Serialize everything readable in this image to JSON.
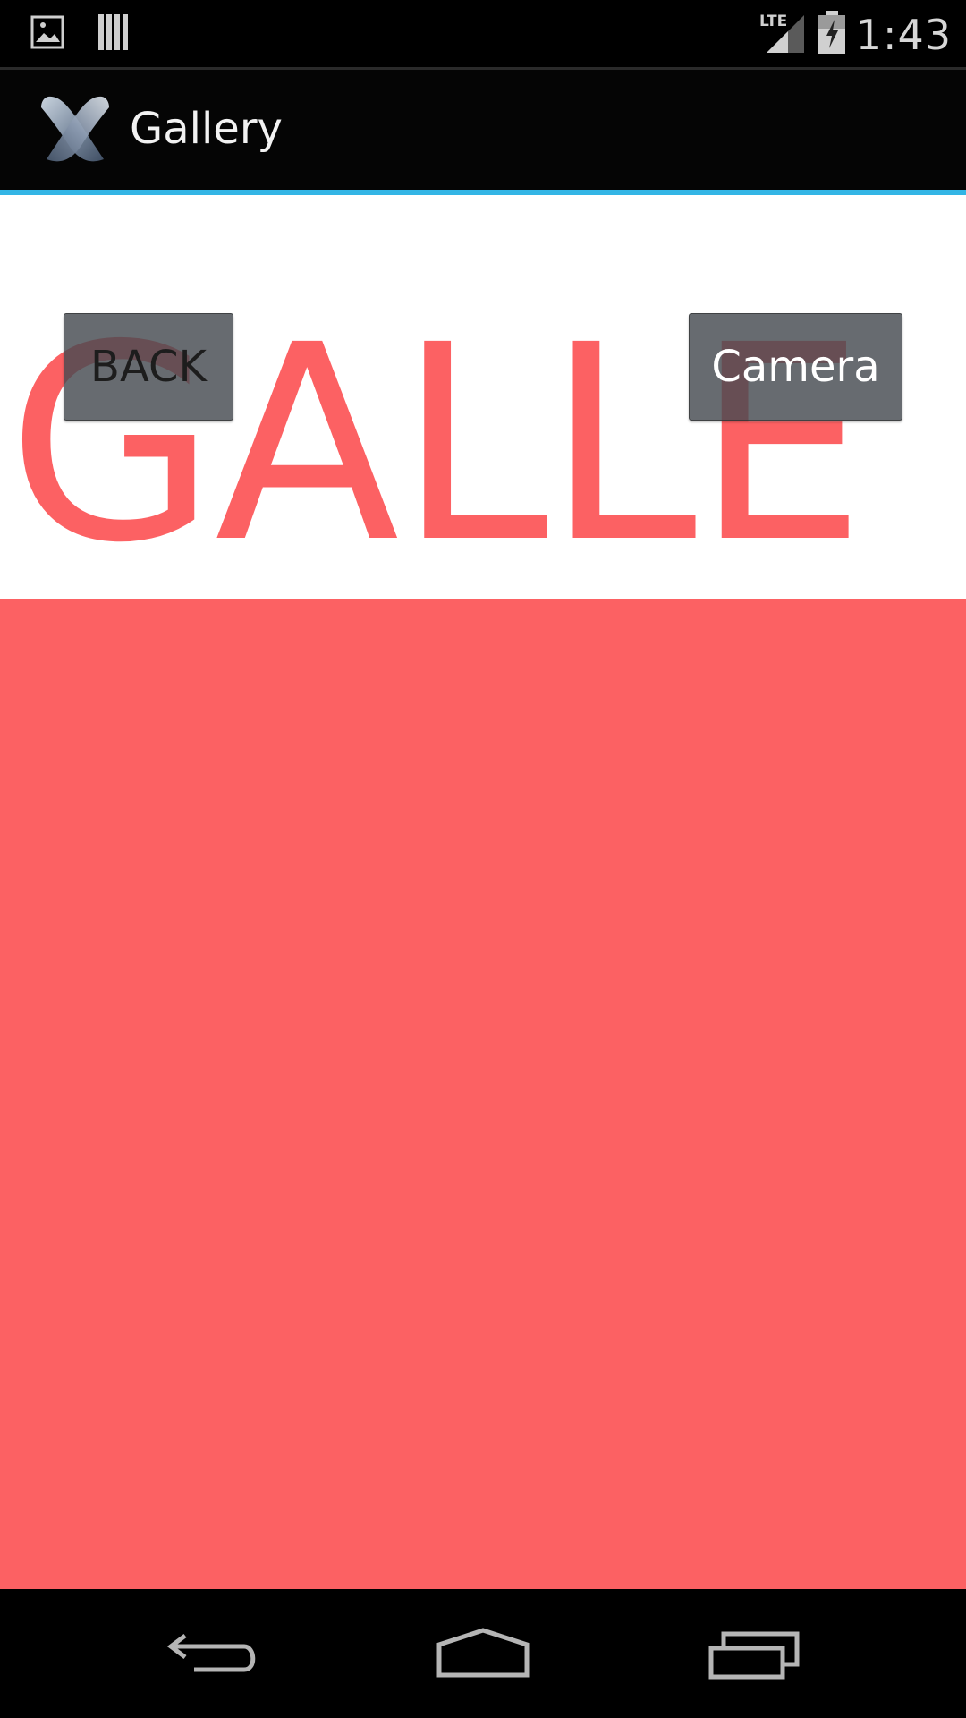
{
  "status_bar": {
    "time": "1:43",
    "network_label": "LTE",
    "icons": [
      "gallery-notification-icon",
      "barcode-notification-icon",
      "lte-signal-icon",
      "battery-charging-icon"
    ]
  },
  "action_bar": {
    "title": "Gallery",
    "app_icon": "xamarin-logo-icon"
  },
  "content": {
    "heading": "GALLE",
    "back_button_label": "BACK",
    "camera_button_label": "Camera"
  },
  "nav_bar": {
    "icons": [
      "back-nav-icon",
      "home-nav-icon",
      "recents-nav-icon"
    ]
  },
  "colors": {
    "accent": "#33b5e5",
    "heading": "#fc6163",
    "panel": "#fc6163",
    "background": "#ffffff",
    "bar": "#000000"
  }
}
